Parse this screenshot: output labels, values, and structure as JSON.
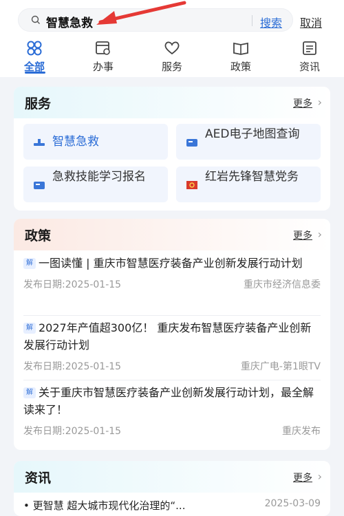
{
  "search": {
    "query": "智慧急救",
    "search_label": "搜索",
    "cancel_label": "取消"
  },
  "tabs": [
    {
      "label": "全部",
      "icon": "grid-icon",
      "active": true
    },
    {
      "label": "办事",
      "icon": "calendar-icon"
    },
    {
      "label": "服务",
      "icon": "heart-icon"
    },
    {
      "label": "政策",
      "icon": "book-icon"
    },
    {
      "label": "资讯",
      "icon": "newspaper-icon"
    }
  ],
  "services": {
    "title": "服务",
    "more": "更多",
    "items": [
      {
        "label": "智慧急救"
      },
      {
        "label": "AED电子地图查询"
      },
      {
        "label": "急救技能学习报名"
      },
      {
        "label": "红岩先锋智慧党务"
      }
    ]
  },
  "policy": {
    "title": "政策",
    "more": "更多",
    "tag": "解",
    "items": [
      {
        "title": "一图读懂 | 重庆市智慧医疗装备产业创新发展行动计划",
        "date": "发布日期:2025-01-15",
        "source": "重庆市经济信息委"
      },
      {
        "title": "2027年产值超300亿！ 重庆发布智慧医疗装备产业创新发展行动计划",
        "date": "发布日期:2025-01-15",
        "source": "重庆广电-第1眼TV"
      },
      {
        "title": "关于重庆市智慧医疗装备产业创新发展行动计划，最全解读来了！",
        "date": "发布日期:2025-01-15",
        "source": "重庆发布"
      }
    ]
  },
  "news": {
    "title": "资讯",
    "more": "更多",
    "items": [
      {
        "title": "• 更智慧 超大城市现代化治理的“...",
        "date": "2025-03-09"
      }
    ]
  },
  "colors": {
    "accent": "#2a6cd6",
    "arrow": "#e53935"
  }
}
